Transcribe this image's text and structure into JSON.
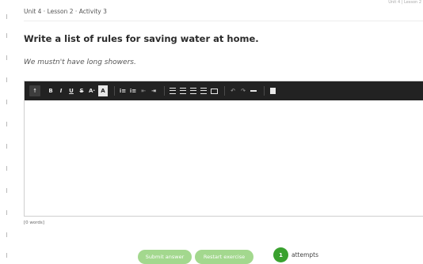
{
  "header": {
    "top_right_note": "Unit 4 | Lesson 2",
    "breadcrumb": "Unit 4 · Lesson 2 · Activity 3"
  },
  "question": {
    "title": "Write a list of rules for saving water at home.",
    "example": "We mustn't have long showers."
  },
  "editor": {
    "text_value": "",
    "toolbar": [
      {
        "name": "accessibility-icon",
        "glyph": "☨"
      },
      {
        "name": "bold-button",
        "glyph": "B"
      },
      {
        "name": "italic-button",
        "glyph": "I"
      },
      {
        "name": "underline-button",
        "glyph": "U"
      },
      {
        "name": "strikethrough-button",
        "glyph": "S"
      },
      {
        "name": "font-color-button",
        "glyph": "A·"
      },
      {
        "name": "highlight-color-button",
        "glyph": "A·"
      },
      {
        "name": "ordered-list-button",
        "glyph": "⁝≡"
      },
      {
        "name": "unordered-list-button",
        "glyph": "⁝≡"
      },
      {
        "name": "outdent-button",
        "glyph": "⇤"
      },
      {
        "name": "indent-button",
        "glyph": "⇥"
      },
      {
        "name": "align-left-button",
        "glyph": "≡"
      },
      {
        "name": "align-center-button",
        "glyph": "≡"
      },
      {
        "name": "align-right-button",
        "glyph": "≡"
      },
      {
        "name": "align-justify-button",
        "glyph": "≡"
      },
      {
        "name": "table-button",
        "glyph": "▭"
      },
      {
        "name": "undo-button",
        "glyph": "↶"
      },
      {
        "name": "redo-button",
        "glyph": "↷"
      },
      {
        "name": "horizontal-rule-button",
        "glyph": "—"
      },
      {
        "name": "paste-document-button",
        "glyph": "▮"
      }
    ]
  },
  "word_count": "[0 words]",
  "actions": {
    "submit_label": "Submit answer",
    "restart_label": "Restart exercise",
    "attempts_count": "1",
    "attempts_label": "attempts"
  },
  "colors": {
    "toolbar_background": "#222222",
    "button_green_light": "#a3d88e",
    "badge_green": "#3aa12f"
  }
}
